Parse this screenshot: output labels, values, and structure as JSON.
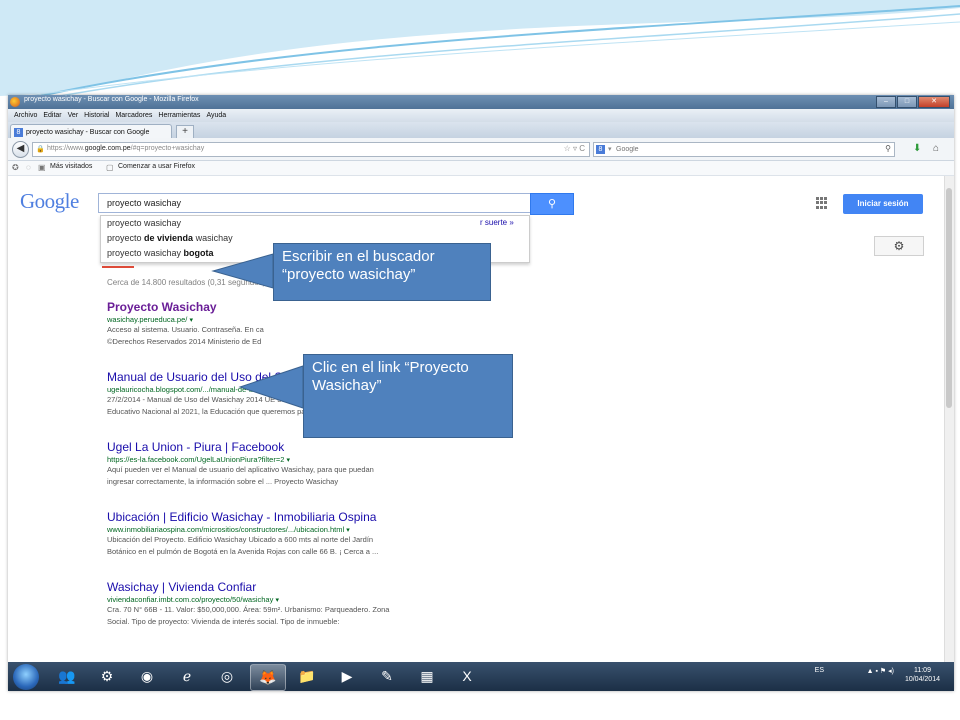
{
  "window": {
    "title": "proyecto wasichay - Buscar con Google - Mozilla Firefox",
    "buttons": {
      "minimize": "–",
      "maximize": "□",
      "close": "✕"
    }
  },
  "menubar": {
    "items": [
      "Archivo",
      "Editar",
      "Ver",
      "Historial",
      "Marcadores",
      "Herramientas",
      "Ayuda"
    ]
  },
  "tabs": [
    {
      "label": "proyecto wasichay - Buscar con Google"
    }
  ],
  "new_tab": "+",
  "navbar": {
    "url_prefix": "https://www.",
    "url_domain": "google.com.pe",
    "url_rest": "/#q=proyecto+wasichay",
    "search_engine_placeholder": "Google"
  },
  "bookmarks": {
    "most_visited": "Más visitados",
    "getting_started": "Comenzar a usar Firefox"
  },
  "google": {
    "logo": "Google",
    "query": "proyecto wasichay",
    "sign_in": "Iniciar sesión",
    "lucky_suffix": "r suerte »",
    "suggestions": [
      {
        "pre": "proyecto wasichay",
        "bold": "",
        "post": ""
      },
      {
        "pre": "proyecto ",
        "bold": "de vivienda",
        "post": " wasichay"
      },
      {
        "pre": "proyecto wasichay ",
        "bold": "bogota",
        "post": ""
      }
    ],
    "stats": "Cerca de 14.800 resultados (0,31 segundos)",
    "results": [
      {
        "title": "Proyecto Wasichay",
        "url": "wasichay.perueduca.pe/",
        "snippet1": "Acceso al sistema. Usuario. Contraseña. En ca",
        "snippet2": "©Derechos Reservados 2014 Ministerio de Ed"
      },
      {
        "title": "Manual de Usuario del Uso del Sistema WASICHAY Manteni...",
        "url": "ugelauricocha.blogspot.com/.../manual-de-usuario-del-uso-del-sistema.ht...",
        "snippet1": "27/2/2014 - Manual de Uso del Wasichay 2014 UE 309 E-Lauricocha ... Proyecto",
        "snippet2": "Educativo Nacional al 2021, la Educación que queremos para el Perú."
      },
      {
        "title": "Ugel La Union - Piura | Facebook",
        "url": "https://es-la.facebook.com/UgelLaUnionPiura?filter=2",
        "snippet1": "Aquí pueden ver el Manual de usuario del aplicativo Wasichay, para que puedan",
        "snippet2": "ingresar correctamente, la información sobre el ... Proyecto Wasichay"
      },
      {
        "title": "Ubicación | Edificio Wasichay - Inmobiliaria Ospina",
        "url": "www.inmobiliariaospina.com/micrositios/constructores/.../ubicacion.html",
        "snippet1": "Ubicación del Proyecto. Edificio Wasichay Ubicado a 600 mts al norte del Jardín",
        "snippet2": "Botánico en el pulmón de Bogotá en la Avenida Rojas con calle 66 B. ¡ Cerca a ..."
      },
      {
        "title": "Wasichay | Vivienda Confiar",
        "url": "viviendaconfiar.imbt.com.co/proyecto/50/wasichay",
        "snippet1": "Cra. 70 N° 66B - 11. Valor: $50,000,000. Área: 59m². Urbanismo: Parqueadero. Zona",
        "snippet2": "Social. Tipo de proyecto: Vivienda de interés social. Tipo de inmueble:"
      }
    ]
  },
  "callouts": {
    "search": "Escribir en el buscador “proyecto wasichay”",
    "link": "Clic en el link “Proyecto Wasichay”"
  },
  "taskbar": {
    "lang": "ES",
    "time": "11:09",
    "date": "10/04/2014"
  },
  "icons": [
    "firefox-icon",
    "back-icon",
    "lock-icon",
    "reload-icon",
    "search-icon",
    "download-icon",
    "home-icon",
    "apps-grid-icon",
    "gear-icon",
    "start-icon"
  ]
}
